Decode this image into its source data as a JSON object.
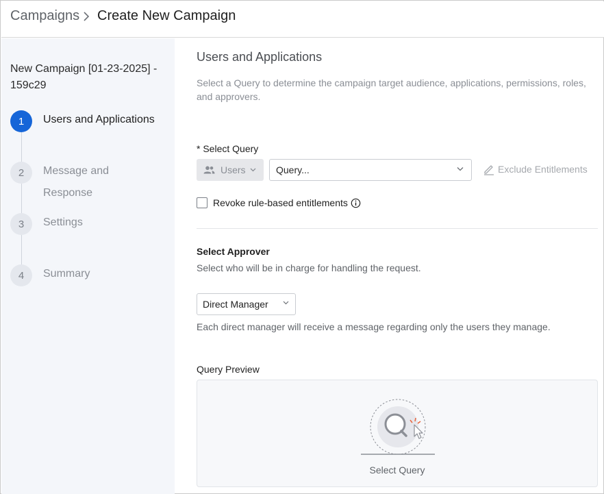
{
  "breadcrumb": {
    "parent": "Campaigns",
    "current": "Create New Campaign"
  },
  "sidebar": {
    "campaign_name": "New Campaign [01-23-2025] - 159c29",
    "steps": [
      {
        "number": "1",
        "label": "Users and Applications",
        "active": true
      },
      {
        "number": "2",
        "label": "Message and Response",
        "active": false
      },
      {
        "number": "3",
        "label": "Settings",
        "active": false
      },
      {
        "number": "4",
        "label": "Summary",
        "active": false
      }
    ]
  },
  "main": {
    "title": "Users and Applications",
    "description": "Select a Query to determine the campaign target audience, applications, permissions, roles, and approvers.",
    "select_query": {
      "label": "* Select Query",
      "scope_button": "Users",
      "query_placeholder": "Query...",
      "exclude_label": "Exclude Entitlements"
    },
    "revoke": {
      "label": "Revoke rule-based entitlements",
      "checked": false
    },
    "approver": {
      "title": "Select Approver",
      "description": "Select who will be in charge for handling the request.",
      "selected": "Direct Manager",
      "note": "Each direct manager will receive a message regarding only the users they manage."
    },
    "preview": {
      "label": "Query Preview",
      "caption": "Select Query"
    }
  },
  "icons": {
    "breadcrumb_separator": "chevron-right-icon",
    "scope": "users-icon",
    "dropdown": "chevron-down-icon",
    "exclude": "pencil-icon",
    "info": "info-icon",
    "preview": "query-search-illustration"
  },
  "colors": {
    "accent": "#1565d8",
    "sidebar_bg": "#f4f6fa",
    "muted_text": "#8a8e95"
  }
}
